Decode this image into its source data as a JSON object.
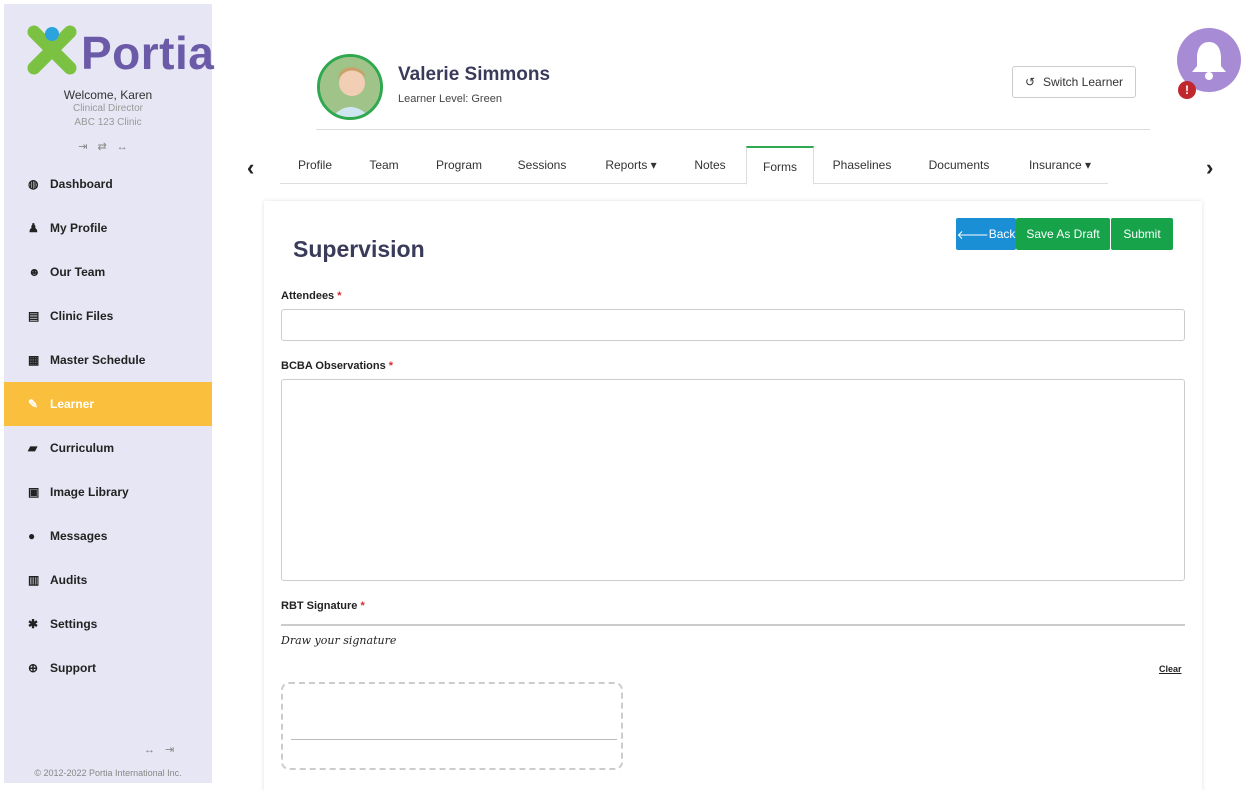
{
  "sidebar": {
    "brand": "Portia",
    "welcome": "Welcome, Karen",
    "role": "Clinical Director",
    "clinic": "ABC 123 Clinic",
    "items": [
      {
        "label": "Dashboard",
        "icon": "dashboard-icon"
      },
      {
        "label": "My Profile",
        "icon": "user-icon"
      },
      {
        "label": "Our Team",
        "icon": "team-icon"
      },
      {
        "label": "Clinic Files",
        "icon": "file-icon"
      },
      {
        "label": "Master Schedule",
        "icon": "calendar-icon"
      },
      {
        "label": "Learner",
        "icon": "pencil-icon"
      },
      {
        "label": "Curriculum",
        "icon": "book-icon"
      },
      {
        "label": "Image Library",
        "icon": "image-icon"
      },
      {
        "label": "Messages",
        "icon": "chat-icon"
      },
      {
        "label": "Audits",
        "icon": "bar-chart-icon"
      },
      {
        "label": "Settings",
        "icon": "gear-icon"
      },
      {
        "label": "Support",
        "icon": "lifebuoy-icon"
      }
    ],
    "active_item": "Learner",
    "copyright": "© 2012-2022 Portia International Inc."
  },
  "learner": {
    "name": "Valerie Simmons",
    "level": "Learner Level: Green"
  },
  "header": {
    "switch_label": "Switch Learner",
    "alert_badge": "!"
  },
  "tabs": [
    {
      "label": "Profile"
    },
    {
      "label": "Team"
    },
    {
      "label": "Program"
    },
    {
      "label": "Sessions"
    },
    {
      "label": "Reports ▾"
    },
    {
      "label": "Notes"
    },
    {
      "label": "Forms"
    },
    {
      "label": "Phaselines"
    },
    {
      "label": "Documents"
    },
    {
      "label": "Insurance ▾"
    }
  ],
  "active_tab": "Forms",
  "form": {
    "title": "Supervision",
    "back_label": "Back",
    "draft_label": "Save As Draft",
    "submit_label": "Submit",
    "attendees_label": "Attendees",
    "attendees_value": "",
    "observations_label": "BCBA Observations",
    "observations_value": "",
    "signature_label": "RBT Signature",
    "signature_hint": "Draw your signature",
    "clear_label": "Clear",
    "required_mark": "*"
  },
  "colors": {
    "sidebar_bg": "#e6e6f4",
    "active_nav": "#fbbf3e",
    "brand_purple": "#6b5aa8",
    "back_blue": "#1a8fd6",
    "action_green": "#16a34a",
    "bell_purple": "#a78bd4"
  }
}
